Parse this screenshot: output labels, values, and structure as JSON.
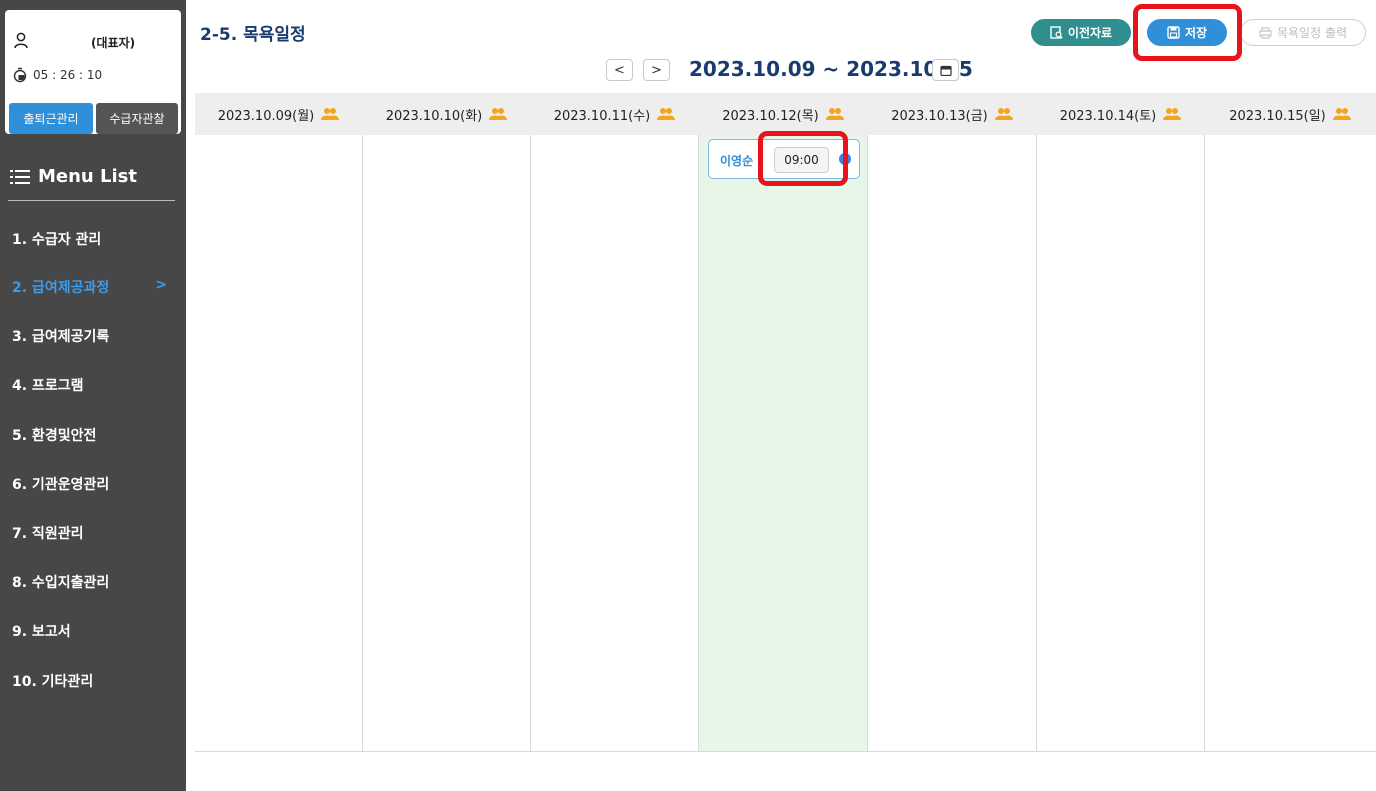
{
  "user": {
    "role": "(대표자)",
    "timer": "05 : 26 : 10"
  },
  "card_buttons": {
    "attendance": "출퇴근관리",
    "observe": "수급자관찰"
  },
  "menu": {
    "title": "Menu List",
    "items": [
      {
        "label": "1. 수급자 관리",
        "active": false
      },
      {
        "label": "2. 급여제공과정",
        "active": true
      },
      {
        "label": "3. 급여제공기록",
        "active": false
      },
      {
        "label": "4. 프로그램",
        "active": false
      },
      {
        "label": "5. 환경및안전",
        "active": false
      },
      {
        "label": "6. 기관운영관리",
        "active": false
      },
      {
        "label": "7. 직원관리",
        "active": false
      },
      {
        "label": "8. 수입지출관리",
        "active": false
      },
      {
        "label": "9. 보고서",
        "active": false
      },
      {
        "label": "10. 기타관리",
        "active": false
      }
    ],
    "active_chevron": ">"
  },
  "header": {
    "title": "2-5. 목욕일정",
    "prev_data": "이전자료",
    "save": "저장",
    "print": "목욕일정 출력",
    "prev_week": "<",
    "next_week": ">",
    "date_range": "2023.10.09 ~ 2023.10.15"
  },
  "days": [
    {
      "label": "2023.10.09(월)",
      "today": false
    },
    {
      "label": "2023.10.10(화)",
      "today": false
    },
    {
      "label": "2023.10.11(수)",
      "today": false
    },
    {
      "label": "2023.10.12(목)",
      "today": true
    },
    {
      "label": "2023.10.13(금)",
      "today": false
    },
    {
      "label": "2023.10.14(토)",
      "today": false
    },
    {
      "label": "2023.10.15(일)",
      "today": false
    }
  ],
  "event": {
    "name": "이영순",
    "time": "09:00"
  },
  "colors": {
    "sidebar_bg": "#474747",
    "accent_blue": "#2f8fd8",
    "teal": "#2f8f8f",
    "title_navy": "#1a3b6e",
    "today_bg": "#e8f6ea",
    "highlight_red": "#e8141c",
    "people_icon": "#f4a51c"
  },
  "icons": {
    "user": "user-icon",
    "timer": "stopwatch-icon",
    "menu": "hamburger-icon",
    "prev_data": "document-search-icon",
    "save": "floppy-disk-icon",
    "print": "printer-icon",
    "calendar": "calendar-icon",
    "day_people": "people-icon"
  }
}
